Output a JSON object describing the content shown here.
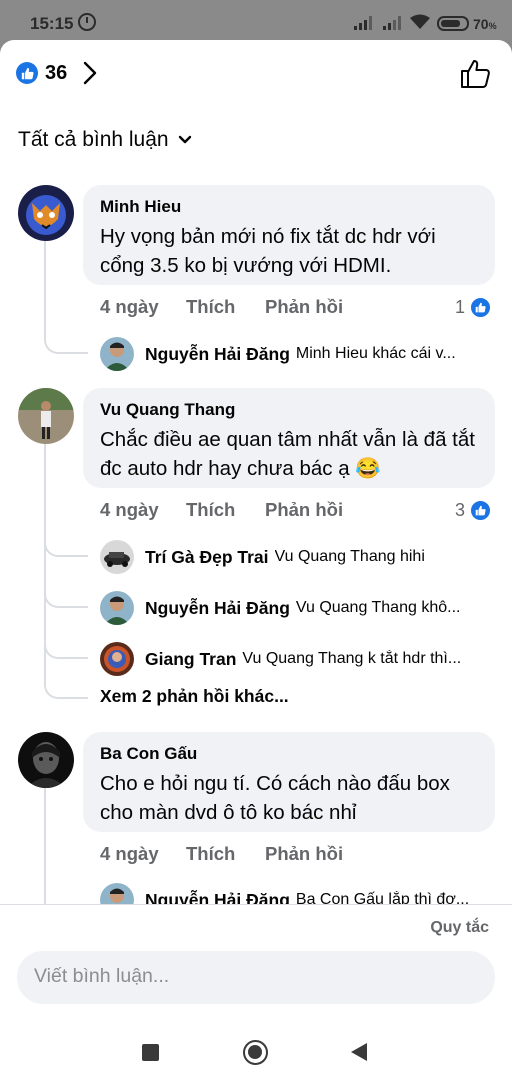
{
  "status": {
    "time": "15:15",
    "battery": "70"
  },
  "header": {
    "reaction_count": "36"
  },
  "filter": {
    "label": "Tất cả bình luận"
  },
  "comments": [
    {
      "name": "Minh Hieu",
      "text": "Hy vọng bản mới nó fix tắt dc hdr với cổng 3.5 ko bị vướng với HDMI.",
      "time": "4 ngày",
      "like": "Thích",
      "reply": "Phản hồi",
      "reactions": "1",
      "replies": [
        {
          "name": "Nguyễn Hải Đăng",
          "text": "Minh Hieu khác cái v..."
        }
      ]
    },
    {
      "name": "Vu Quang Thang",
      "text": "Chắc điều ae quan tâm nhất vẫn là đã tắt đc auto hdr hay chưa bác ạ 😂",
      "time": "4 ngày",
      "like": "Thích",
      "reply": "Phản hồi",
      "reactions": "3",
      "replies": [
        {
          "name": "Trí Gà Đẹp Trai",
          "text": "Vu Quang Thang hihi"
        },
        {
          "name": "Nguyễn Hải Đăng",
          "text": "Vu Quang Thang khô..."
        },
        {
          "name": "Giang Tran",
          "text": "Vu Quang Thang k tắt hdr thì..."
        }
      ],
      "more_replies": "Xem 2 phản hồi khác..."
    },
    {
      "name": "Ba Con Gấu",
      "text": "Cho e hỏi ngu tí. Có cách nào đấu box cho màn dvd ô tô ko bác nhỉ",
      "time": "4 ngày",
      "like": "Thích",
      "reply": "Phản hồi",
      "replies": [
        {
          "name": "Nguyễn Hải Đăng",
          "text": "Ba Con Gấu lắp thì đơ..."
        }
      ]
    }
  ],
  "footer": {
    "rules": "Quy tắc",
    "placeholder": "Viết bình luận..."
  },
  "colors": {
    "accent": "#1b74e4",
    "bubble": "#f0f2f5",
    "secondary_text": "#65676b"
  }
}
